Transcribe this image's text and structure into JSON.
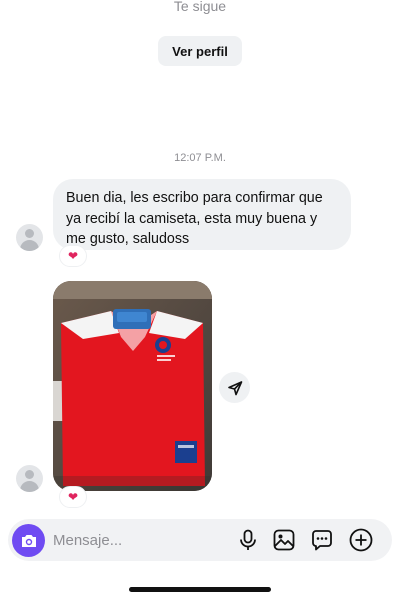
{
  "profile_header": {
    "follow_status": "Te sigue",
    "view_profile_label": "Ver perfil"
  },
  "conversation": {
    "timestamp": "12:07 P.M.",
    "messages": [
      {
        "type": "text",
        "text": "Buen dia, les escribo para confirmar que ya recibí la camiseta, esta muy buena y me gusto, saludoss",
        "reaction": "❤"
      },
      {
        "type": "photo",
        "description_icon": "red-jersey-photo",
        "reaction": "❤"
      }
    ]
  },
  "composer": {
    "placeholder": "Mensaje...",
    "icons": [
      "camera-icon",
      "microphone-icon",
      "gallery-icon",
      "sticker-icon",
      "plus-icon"
    ]
  },
  "colors": {
    "accent": "#6f4bf2",
    "bubble": "#eff1f3",
    "reaction": "#e0245e"
  }
}
